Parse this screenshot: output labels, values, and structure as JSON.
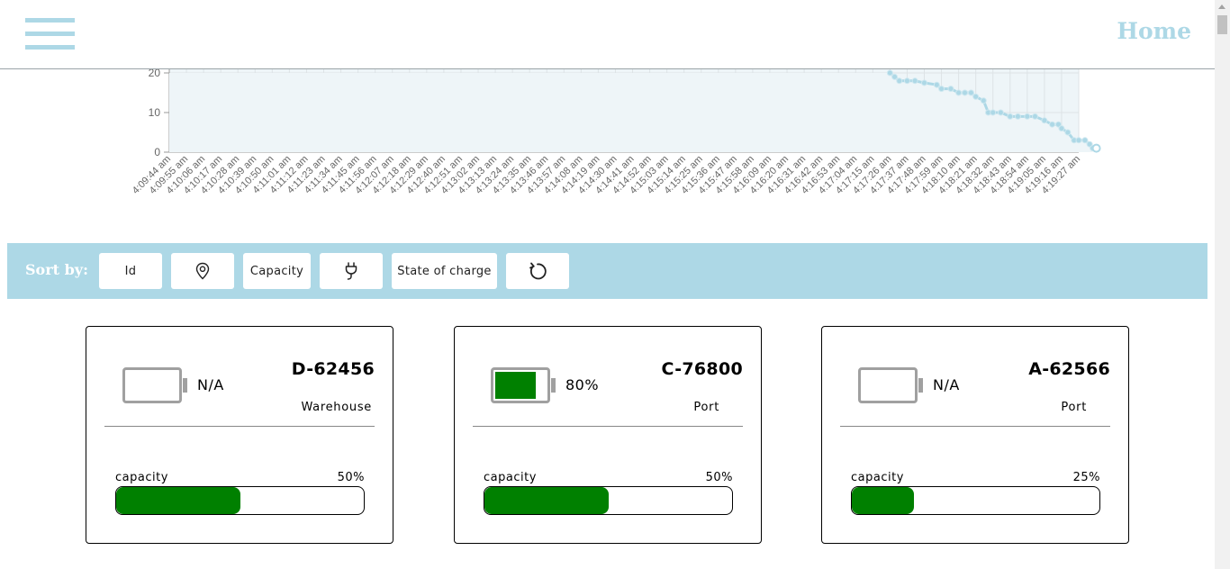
{
  "header": {
    "menu_icon": "hamburger-menu-icon",
    "home_label": "Home",
    "accent_color": "#add8e6"
  },
  "chart_data": {
    "type": "area",
    "title": "",
    "xlabel": "",
    "ylabel": "",
    "y_ticks": [
      0,
      10,
      20
    ],
    "ylim": [
      0,
      20
    ],
    "grid": true,
    "color": "#add8e6",
    "x_tick_labels": [
      "4:09:44 am",
      "4:09:55 am",
      "4:10:06 am",
      "4:10:17 am",
      "4:10:28 am",
      "4:10:39 am",
      "4:10:50 am",
      "4:11:01 am",
      "4:11:12 am",
      "4:11:23 am",
      "4:11:34 am",
      "4:11:45 am",
      "4:11:56 am",
      "4:12:07 am",
      "4:12:18 am",
      "4:12:29 am",
      "4:12:40 am",
      "4:12:51 am",
      "4:13:02 am",
      "4:13:13 am",
      "4:13:24 am",
      "4:13:35 am",
      "4:13:46 am",
      "4:13:57 am",
      "4:14:08 am",
      "4:14:19 am",
      "4:14:30 am",
      "4:14:41 am",
      "4:14:52 am",
      "4:15:03 am",
      "4:15:14 am",
      "4:15:25 am",
      "4:15:36 am",
      "4:15:47 am",
      "4:15:58 am",
      "4:16:09 am",
      "4:16:20 am",
      "4:16:31 am",
      "4:16:42 am",
      "4:16:53 am",
      "4:17:04 am",
      "4:17:15 am",
      "4:17:26 am",
      "4:17:37 am",
      "4:17:48 am",
      "4:17:59 am",
      "4:18:10 am",
      "4:18:21 am",
      "4:18:32 am",
      "4:18:43 am",
      "4:18:54 am",
      "4:19:05 am",
      "4:19:16 am",
      "4:19:27 am"
    ],
    "series": [
      {
        "x": [
          "4:17:26 am",
          "4:17:29 am",
          "4:17:32 am",
          "4:17:37 am",
          "4:17:42 am",
          "4:17:48 am",
          "4:17:56 am",
          "4:17:59 am",
          "4:18:05 am",
          "4:18:10 am",
          "4:18:14 am",
          "4:18:18 am",
          "4:18:21 am",
          "4:18:26 am",
          "4:18:29 am",
          "4:18:32 am",
          "4:18:37 am",
          "4:18:43 am",
          "4:18:48 am",
          "4:18:54 am",
          "4:18:59 am",
          "4:19:05 am",
          "4:19:10 am",
          "4:19:14 am",
          "4:19:16 am",
          "4:19:20 am",
          "4:19:24 am",
          "4:19:27 am",
          "4:19:31 am",
          "4:19:34 am",
          "4:19:36 am"
        ],
        "values": [
          20,
          19,
          18,
          18,
          18,
          17.5,
          17,
          16,
          16,
          15,
          15,
          15,
          14,
          13,
          10,
          10,
          10,
          9,
          9,
          9,
          9,
          8,
          7,
          7,
          6,
          5,
          3,
          3,
          3,
          2,
          1
        ]
      }
    ]
  },
  "sortbar": {
    "label": "Sort by:",
    "buttons": {
      "id": "Id",
      "location_icon": "location-pin-icon",
      "capacity": "Capacity",
      "plug_icon": "plug-icon",
      "state_of_charge": "State of charge",
      "reset_icon": "refresh-icon"
    }
  },
  "cards": [
    {
      "id": "D-62456",
      "location": "Warehouse",
      "soc_text": "N/A",
      "soc_level": 0,
      "capacity_label": "capacity",
      "capacity_text": "50%",
      "capacity_level": 0.5,
      "battery_icon": "battery-icon"
    },
    {
      "id": "C-76800",
      "location": "Port",
      "soc_text": "80%",
      "soc_level": 0.8,
      "capacity_label": "capacity",
      "capacity_text": "50%",
      "capacity_level": 0.5,
      "battery_icon": "battery-icon"
    },
    {
      "id": "A-62566",
      "location": "Port",
      "soc_text": "N/A",
      "soc_level": 0,
      "capacity_label": "capacity",
      "capacity_text": "25%",
      "capacity_level": 0.25,
      "battery_icon": "battery-icon"
    }
  ],
  "colors": {
    "fill_green": "#008000",
    "battery_frame": "#a0a0a0"
  }
}
